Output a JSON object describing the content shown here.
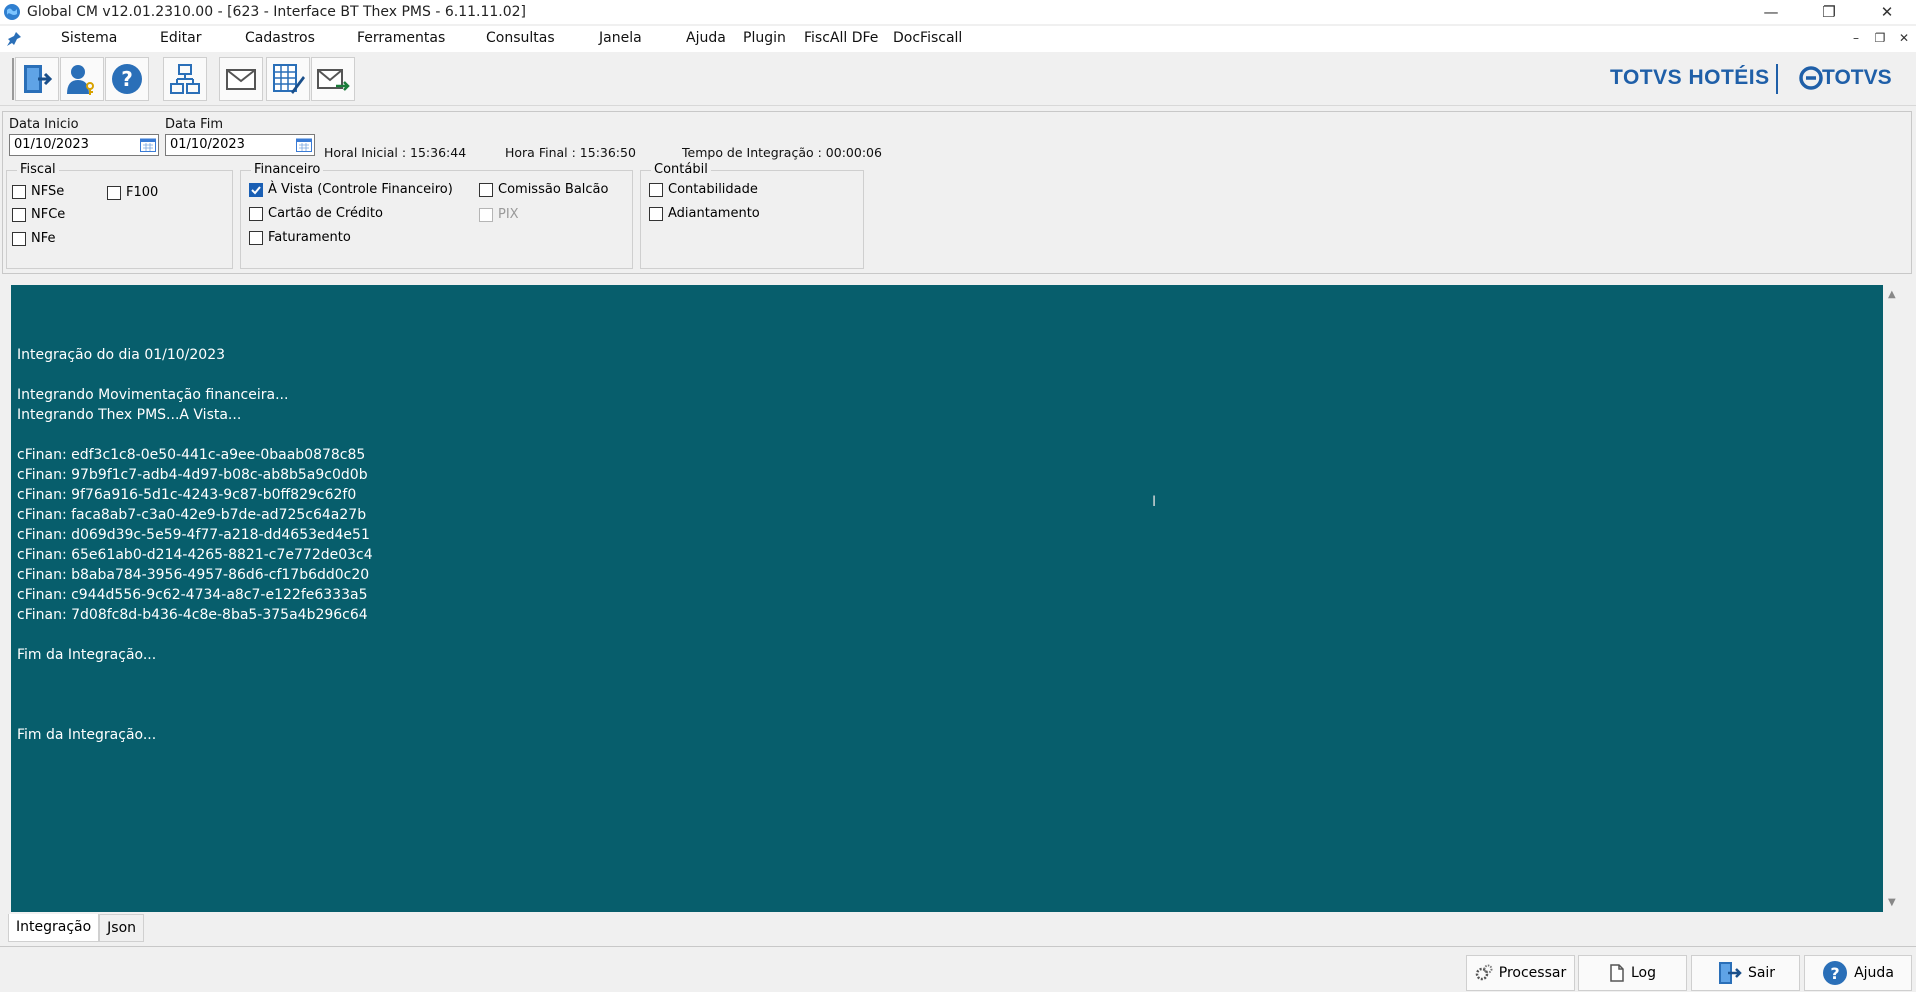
{
  "window": {
    "title": "Global CM v12.01.2310.00 - [623 - Interface BT Thex PMS - 6.11.11.02]"
  },
  "menu": [
    {
      "label": "Sistema"
    },
    {
      "label": "Editar"
    },
    {
      "label": "Cadastros"
    },
    {
      "label": "Ferramentas"
    },
    {
      "label": "Consultas"
    },
    {
      "label": "Janela"
    },
    {
      "label": "Ajuda"
    },
    {
      "label": "Plugin"
    },
    {
      "label": "FiscAll DFe"
    },
    {
      "label": "DocFiscall"
    }
  ],
  "brand": {
    "hoteis": "TOTVS HOTÉIS",
    "totvs": "TOTVS",
    "color": "#1f5fa8"
  },
  "filters": {
    "data_inicio_label": "Data Inicio",
    "data_inicio_value": "01/10/2023",
    "data_fim_label": "Data Fim",
    "data_fim_value": "01/10/2023",
    "hora_inicial": "Horal Inicial : 15:36:44",
    "hora_final": "Hora Final : 15:36:50",
    "tempo_integracao": "Tempo de Integração :  00:00:06"
  },
  "fiscal": {
    "legend": "Fiscal",
    "nfse": "NFSe",
    "nfce": "NFCe",
    "nfe": "NFe",
    "f100": "F100"
  },
  "financeiro": {
    "legend": "Financeiro",
    "a_vista": "À Vista (Controle Financeiro)",
    "cartao": "Cartão de Crédito",
    "faturamento": "Faturamento",
    "comissao": "Comissão Balcão",
    "pix": "PIX"
  },
  "contabil": {
    "legend": "Contábil",
    "contabilidade": "Contabilidade",
    "adiantamento": "Adiantamento"
  },
  "log": {
    "background": "#075e6c",
    "lines": [
      "",
      "Integração do dia 01/10/2023",
      "",
      "Integrando Movimentação financeira...",
      "Integrando Thex PMS...A Vista...",
      "",
      "cFinan: edf3c1c8-0e50-441c-a9ee-0baab0878c85",
      "cFinan: 97b9f1c7-adb4-4d97-b08c-ab8b5a9c0d0b",
      "cFinan: 9f76a916-5d1c-4243-9c87-b0ff829c62f0",
      "cFinan: faca8ab7-c3a0-42e9-b7de-ad725c64a27b",
      "cFinan: d069d39c-5e59-4f77-a218-dd4653ed4e51",
      "cFinan: 65e61ab0-d214-4265-8821-c7e772de03c4",
      "cFinan: b8aba784-3956-4957-86d6-cf17b6dd0c20",
      "cFinan: c944d556-9c62-4734-a8c7-e122fe6333a5",
      "cFinan: 7d08fc8d-b436-4c8e-8ba5-375a4b296c64",
      "",
      "Fim da Integração...",
      "",
      "",
      "",
      "Fim da Integração..."
    ]
  },
  "tabs": [
    {
      "label": "Integração"
    },
    {
      "label": "Json"
    }
  ],
  "buttons": {
    "processar": "Processar",
    "log": "Log",
    "sair": "Sair",
    "ajuda": "Ajuda"
  }
}
